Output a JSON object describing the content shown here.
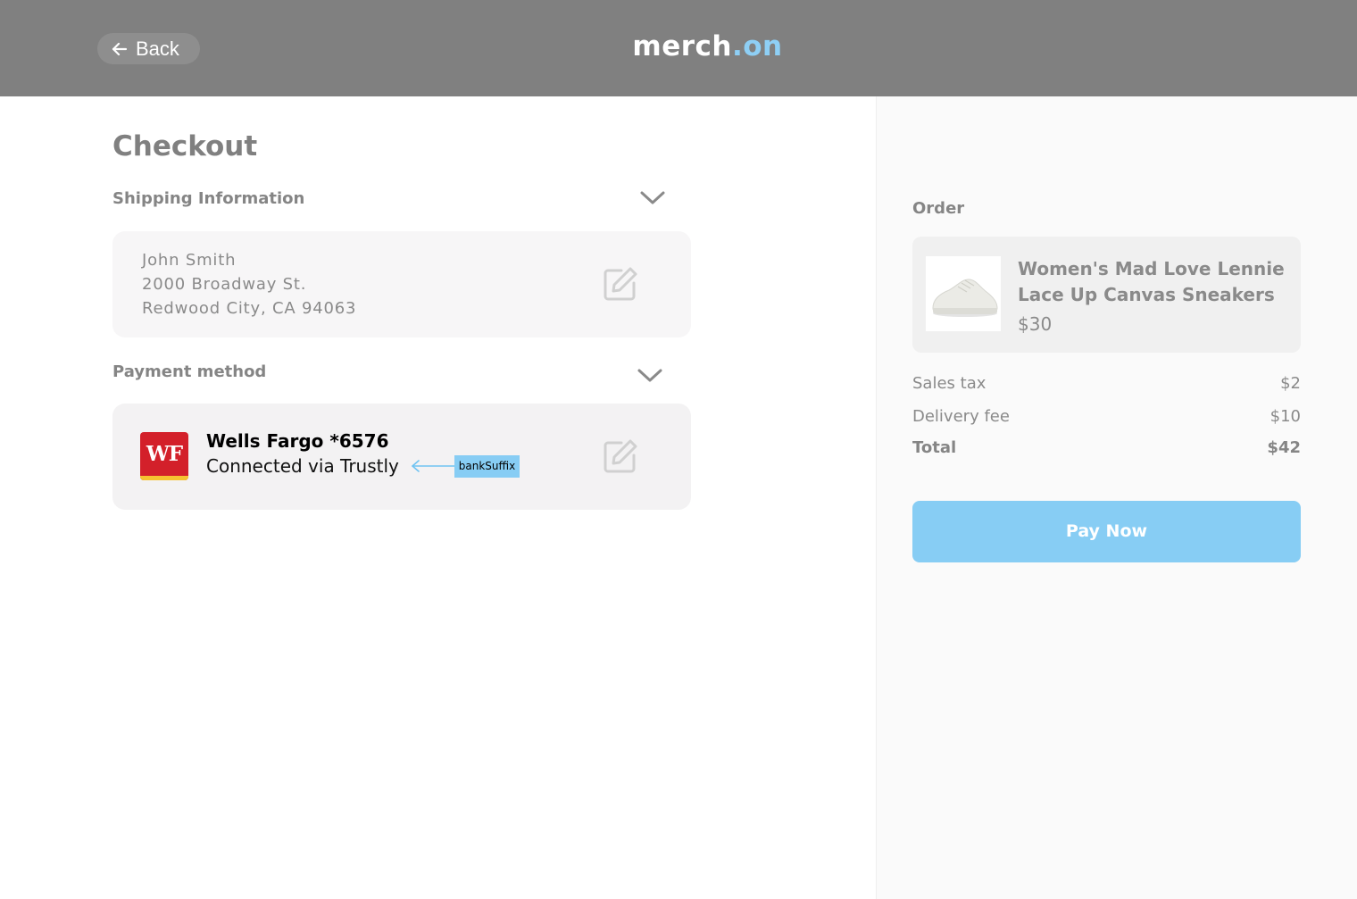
{
  "header": {
    "back_label": "Back",
    "logo_main": "merch",
    "logo_accent": ".on"
  },
  "checkout": {
    "title": "Checkout",
    "shipping": {
      "label": "Shipping Information",
      "name": "John Smith",
      "street": "2000 Broadway St.",
      "city": "Redwood City, CA 94063"
    },
    "payment": {
      "label": "Payment method",
      "bank_logo_text": "WF",
      "bank_name": "Wells Fargo *6576",
      "bank_sub": "Connected via Trustly",
      "annotation_tag": "bankSuffix"
    }
  },
  "order": {
    "label": "Order",
    "product_name": "Women's Mad Love Lennie Lace Up Canvas Sneakers",
    "product_price": "$30",
    "sales_tax_label": "Sales tax",
    "sales_tax_value": "$2",
    "delivery_label": "Delivery fee",
    "delivery_value": "$10",
    "total_label": "Total",
    "total_value": "$42",
    "pay_button": "Pay Now"
  },
  "colors": {
    "header_bg": "#808080",
    "accent": "#87cdf4",
    "wf_red": "#d3202a",
    "wf_gold": "#f6c231"
  }
}
